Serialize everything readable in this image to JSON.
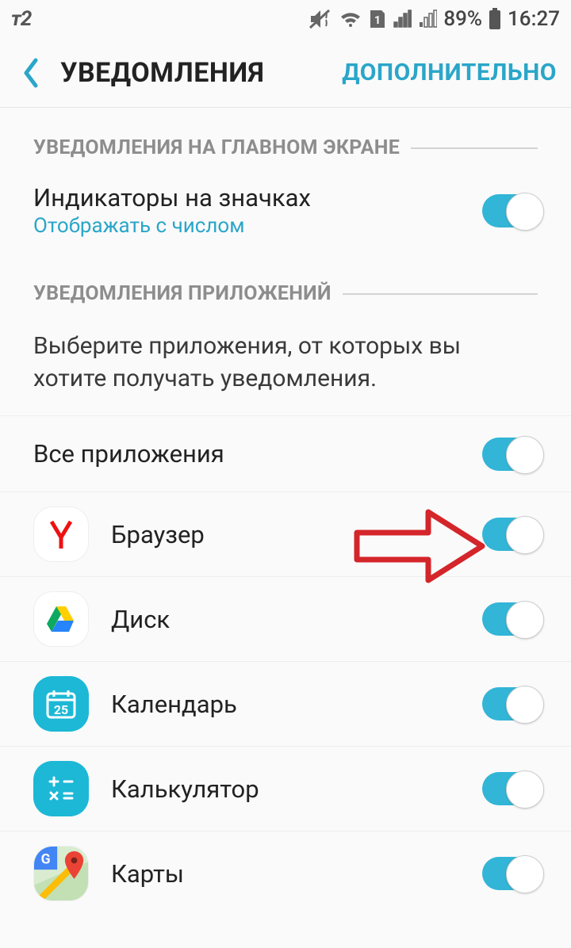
{
  "status": {
    "carrier": "т2",
    "battery_text": "89%",
    "clock": "16:27"
  },
  "header": {
    "title": "УВЕДОМЛЕНИЯ",
    "action": "ДОПОЛНИТЕЛЬНО"
  },
  "sections": {
    "lock_screen_title": "УВЕДОМЛЕНИЯ НА ГЛАВНОМ ЭКРАНЕ",
    "app_notifications_title": "УВЕДОМЛЕНИЯ ПРИЛОЖЕНИЙ"
  },
  "badge_row": {
    "title": "Индикаторы на значках",
    "subtitle": "Отображать с числом",
    "enabled": true
  },
  "description": "Выберите приложения, от которых вы хотите получать уведомления.",
  "all_apps": {
    "label": "Все приложения",
    "enabled": true
  },
  "apps": [
    {
      "name": "Браузер",
      "icon": "yandex-browser",
      "enabled": true
    },
    {
      "name": "Диск",
      "icon": "google-drive",
      "enabled": true
    },
    {
      "name": "Календарь",
      "icon": "calendar",
      "calendar_day": "25",
      "enabled": true
    },
    {
      "name": "Калькулятор",
      "icon": "calculator",
      "enabled": true
    },
    {
      "name": "Карты",
      "icon": "google-maps",
      "enabled": true
    }
  ]
}
